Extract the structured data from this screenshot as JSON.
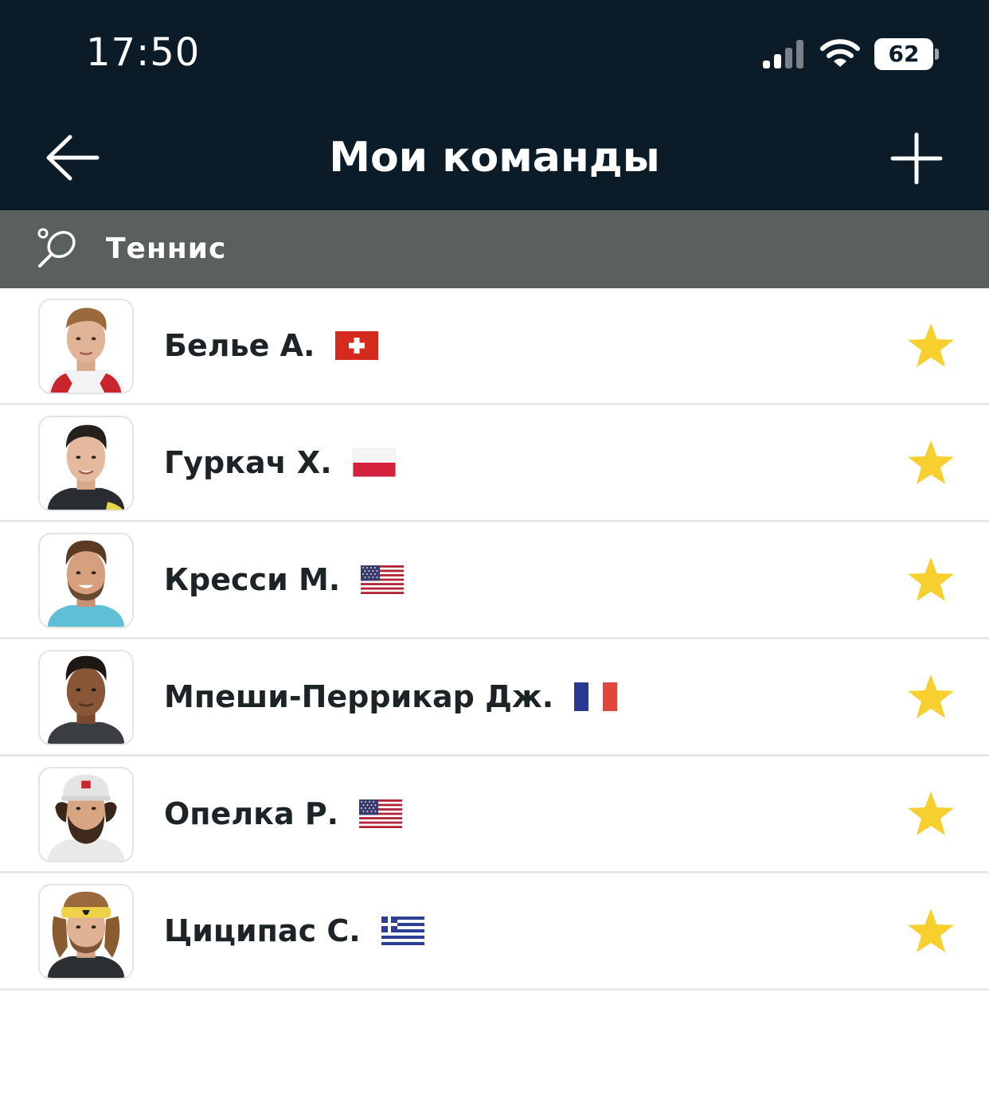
{
  "status_bar": {
    "time": "17:50",
    "battery": "62"
  },
  "header": {
    "title": "Мои команды"
  },
  "section": {
    "title": "Теннис"
  },
  "colors": {
    "header_bg": "#0b1c28",
    "section_bg": "#5a5f60",
    "star": "#f7d02f"
  },
  "players": [
    {
      "name": "Белье А.",
      "country": "switzerland",
      "favorite": true
    },
    {
      "name": "Гуркач Х.",
      "country": "poland",
      "favorite": true
    },
    {
      "name": "Кресси М.",
      "country": "usa",
      "favorite": true
    },
    {
      "name": "Мпеши-Перрикар Дж.",
      "country": "france",
      "favorite": true
    },
    {
      "name": "Опелка Р.",
      "country": "usa",
      "favorite": true
    },
    {
      "name": "Циципас С.",
      "country": "greece",
      "favorite": true
    }
  ]
}
